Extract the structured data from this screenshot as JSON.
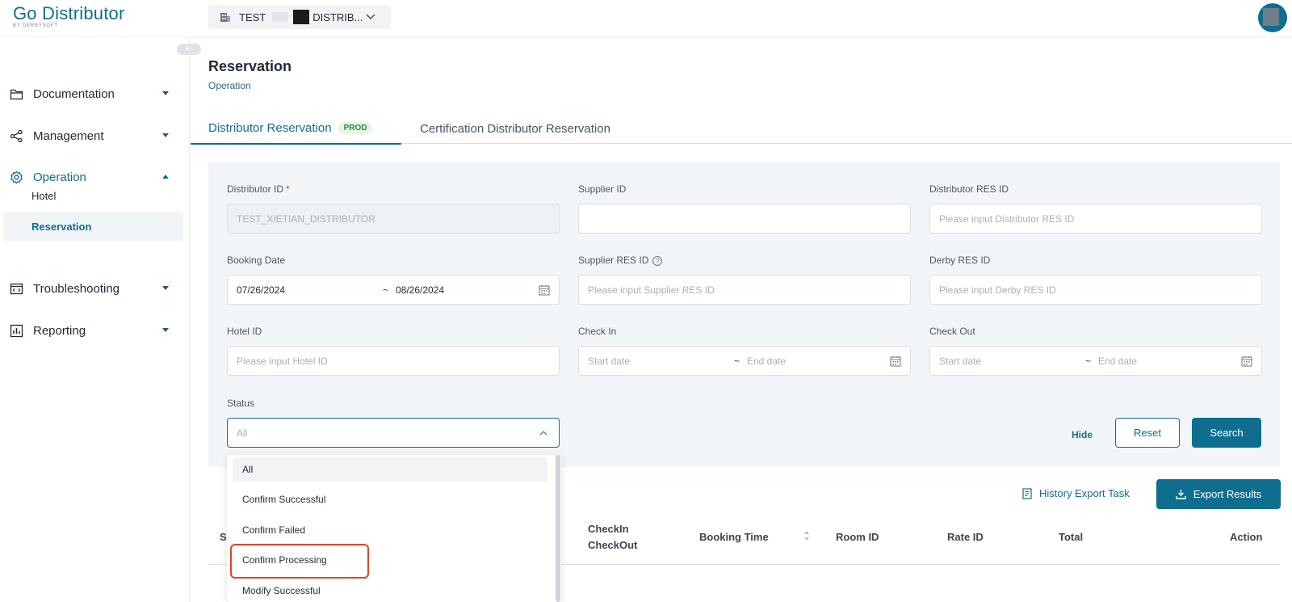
{
  "topbar": {
    "logo": "Go Distributor",
    "logo_sub": "BY DERBYSOFT",
    "tenant_prefix": "TEST",
    "tenant_suffix": "DISTRIB..."
  },
  "sidebar": {
    "items": [
      {
        "label": "Documentation",
        "icon": "folder-icon"
      },
      {
        "label": "Management",
        "icon": "share-icon"
      },
      {
        "label": "Operation",
        "icon": "gear-icon"
      },
      {
        "label": "Troubleshooting",
        "icon": "code-window-icon"
      },
      {
        "label": "Reporting",
        "icon": "bar-chart-icon"
      }
    ],
    "sub_items": [
      {
        "label": "Hotel"
      },
      {
        "label": "Reservation"
      }
    ]
  },
  "page": {
    "title": "Reservation",
    "breadcrumb": "Operation"
  },
  "tabs": [
    {
      "label": "Distributor Reservation",
      "badge": "PROD"
    },
    {
      "label": "Certification Distributor Reservation"
    }
  ],
  "filters": {
    "distributor_id": {
      "label": "Distributor ID",
      "required_mark": "*",
      "value": "TEST_XIETIAN_DISTRIBUTOR"
    },
    "supplier_id": {
      "label": "Supplier ID",
      "value": ""
    },
    "distributor_res_id": {
      "label": "Distributor RES ID",
      "placeholder": "Please input Distributor RES ID"
    },
    "booking_date": {
      "label": "Booking Date",
      "start": "07/26/2024",
      "separator": "~",
      "end": "08/26/2024"
    },
    "supplier_res_id": {
      "label": "Supplier RES ID",
      "help": "?",
      "placeholder": "Please input Supplier RES ID"
    },
    "derby_res_id": {
      "label": "Derby RES ID",
      "placeholder": "Please input Derby RES ID"
    },
    "hotel_id": {
      "label": "Hotel ID",
      "placeholder": "Please input Hotel ID"
    },
    "check_in": {
      "label": "Check In",
      "start_placeholder": "Start date",
      "separator": "~",
      "end_placeholder": "End date"
    },
    "check_out": {
      "label": "Check Out",
      "start_placeholder": "Start date",
      "separator": "~",
      "end_placeholder": "End date"
    },
    "status": {
      "label": "Status",
      "placeholder": "All"
    }
  },
  "actions": {
    "hide": "Hide",
    "reset": "Reset",
    "search": "Search",
    "history_export": "History Export Task",
    "export_results": "Export Results"
  },
  "table": {
    "headers": [
      "S",
      "CheckIn",
      "CheckOut",
      "Booking Time",
      "Room ID",
      "Rate ID",
      "Total",
      "Action"
    ]
  },
  "status_dropdown": {
    "options": [
      "All",
      "Confirm Successful",
      "Confirm Failed",
      "Confirm Processing",
      "Modify Successful"
    ],
    "selected": "All",
    "highlighted": "Confirm Processing"
  },
  "colors": {
    "primary": "#0e6e8f",
    "highlight_box": "#e8402c",
    "badge_text": "#2b8a3e"
  }
}
